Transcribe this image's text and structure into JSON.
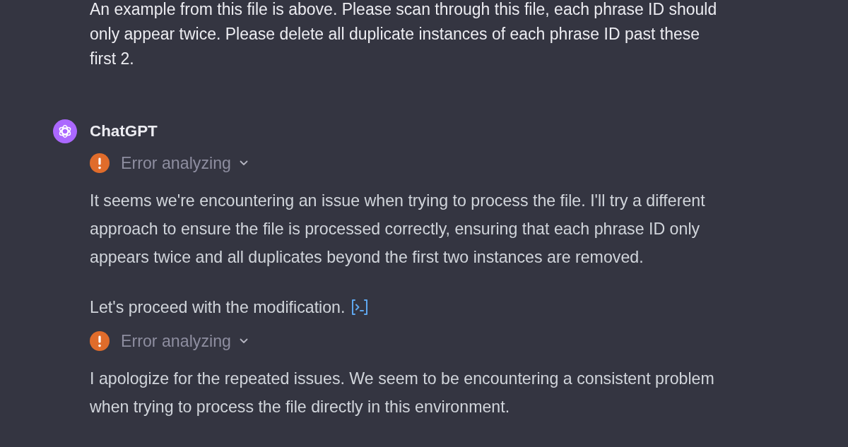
{
  "messages": [
    {
      "kind": "user",
      "text": "An example from this file is above. Please scan through this file, each phrase ID should only appear twice. Please delete all duplicate instances of each phrase ID past these first 2."
    },
    {
      "kind": "assistant",
      "author": "ChatGPT",
      "blocks": [
        {
          "kind": "status",
          "label": "Error analyzing",
          "expanded": false
        },
        {
          "kind": "paragraph",
          "text": "It seems we're encountering an issue when trying to process the file. I'll try a different approach to ensure the file is processed correctly, ensuring that each phrase ID only appears twice and all duplicates beyond the first two instances are removed.",
          "code_link": false
        },
        {
          "kind": "paragraph",
          "text": "Let's proceed with the modification.",
          "code_link": true
        },
        {
          "kind": "status",
          "label": "Error analyzing",
          "expanded": false
        },
        {
          "kind": "paragraph",
          "text": "I apologize for the repeated issues. We seem to be encountering a consistent problem when trying to process the file directly in this environment.",
          "code_link": false
        }
      ]
    }
  ]
}
